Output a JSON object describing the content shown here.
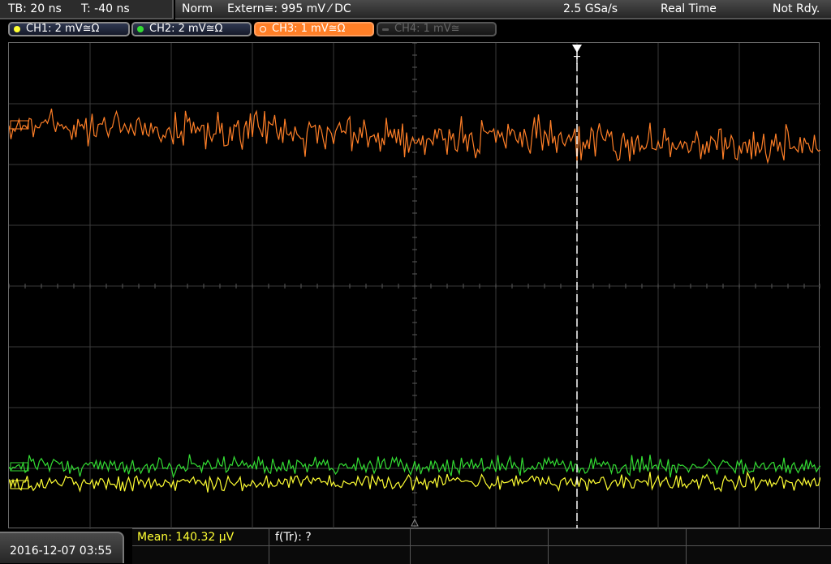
{
  "status": {
    "timebase": "TB: 20 ns",
    "trigger_time": "T: -40 ns",
    "mode": "Norm",
    "trigger_source": "Extern≅: 995 mV ⁄ DC",
    "sample_rate": "2.5 GSa/s",
    "acq_mode": "Real Time",
    "state": "Not Rdy."
  },
  "channels": [
    {
      "label": "CH1: 2 mV≅Ω",
      "color": "#ffff33",
      "state": "on"
    },
    {
      "label": "CH2: 2 mV≅Ω",
      "color": "#33dd33",
      "state": "on"
    },
    {
      "label": "CH3: 1 mV≅Ω",
      "color": "#ff7f27",
      "state": "selected"
    },
    {
      "label": "CH4: 1 mV≅",
      "color": "#666666",
      "state": "off"
    }
  ],
  "trigger_marker": "T",
  "bottom": {
    "datetime": "2016-12-07 03:55",
    "mean": "Mean: 140.32 µV",
    "freq": "f(Tr): ?"
  },
  "colors": {
    "ch1": "#ffff33",
    "ch2": "#33dd33",
    "ch3": "#ff7f27",
    "grid": "#4a4a4a"
  }
}
